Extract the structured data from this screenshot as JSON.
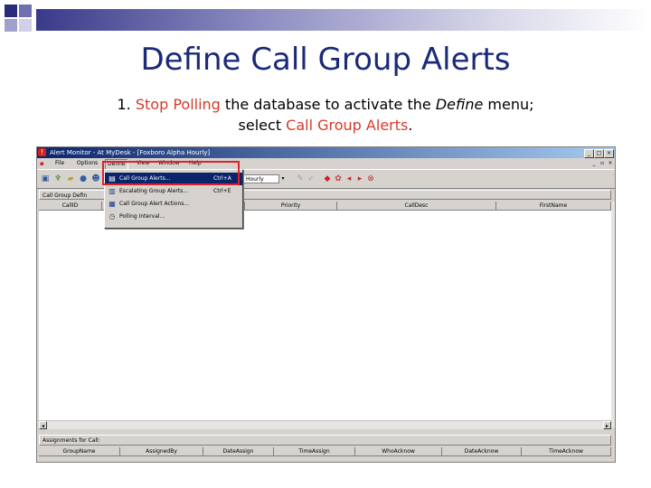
{
  "slide": {
    "title": "Define Call Group Alerts",
    "instruction": {
      "prefix": "1. ",
      "link1": "Stop Polling",
      "mid": " the database to activate the ",
      "em": "Define",
      "mid2": " menu;",
      "line2_prefix": "select ",
      "link2": "Call Group Alerts",
      "suffix": "."
    },
    "accent_color": "#d83a2a",
    "title_color": "#1b2a78"
  },
  "app": {
    "window_title": "Alert Monitor - At MyDesk - [Foxboro Alpha Hourly]",
    "menus": [
      "File",
      "Options",
      "Define",
      "View",
      "Window",
      "Help"
    ],
    "active_menu": "Define",
    "combo_value": "Hourly",
    "panel_title": "Call Group Defin",
    "grid_columns": [
      "CallID",
      "",
      "Priority",
      "CallDesc",
      "FirstName"
    ],
    "panel2_title": "Assignments for Call:",
    "grid2_columns": [
      "GroupName",
      "AssignedBy",
      "DateAssign",
      "TimeAssign",
      "WhoAcknow",
      "DateAcknow",
      "TimeAcknow"
    ],
    "dropdown_items": [
      {
        "label": "Call Group Alerts...",
        "shortcut": "Ctrl+A",
        "icon": "alerts-icon"
      },
      {
        "label": "Escalating Group Alerts...",
        "shortcut": "Ctrl+E",
        "icon": "escalating-icon"
      },
      {
        "label": "Call Group Alert Actions...",
        "shortcut": "",
        "icon": "actions-icon"
      },
      {
        "label": "Polling Interval...",
        "shortcut": "",
        "icon": "clock-icon"
      }
    ]
  }
}
